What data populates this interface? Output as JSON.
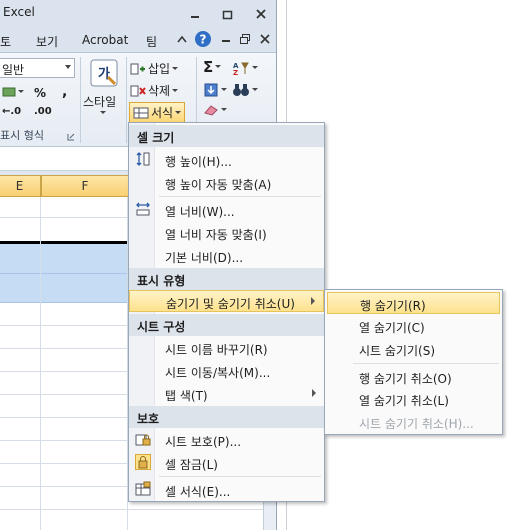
{
  "window": {
    "title": "Excel"
  },
  "menubar": {
    "tabs": [
      "토",
      "보기",
      "Acrobat",
      "팀"
    ]
  },
  "ribbon": {
    "number_format": "일반",
    "percent": "%",
    "comma": ",",
    "inc_decimal": "←.0",
    "dec_decimal": ".00",
    "number_group_label": "표시 형식",
    "style_label": "스타일",
    "insert_label": "삽입",
    "delete_label": "삭제",
    "format_label": "서식",
    "sum_symbol": "Σ"
  },
  "grid": {
    "column_label": "F",
    "column_label_left": "E"
  },
  "menu": {
    "sections": {
      "cell_size": "셀 크기",
      "visibility": "표시 유형",
      "organize": "시트 구성",
      "protection": "보호"
    },
    "items": {
      "row_height": "행 높이(H)...",
      "autofit_row": "행 높이 자동 맞춤(A)",
      "col_width": "열 너비(W)...",
      "autofit_col": "열 너비 자동 맞춤(I)",
      "default_width": "기본 너비(D)...",
      "hide_unhide": "숨기기 및 숨기기 취소(U)",
      "rename_sheet": "시트 이름 바꾸기(R)",
      "move_copy": "시트 이동/복사(M)...",
      "tab_color": "탭 색(T)",
      "protect_sheet": "시트 보호(P)...",
      "lock_cell": "셀 잠금(L)",
      "format_cells": "셀 서식(E)..."
    }
  },
  "submenu": {
    "items": {
      "hide_rows": "행 숨기기(R)",
      "hide_cols": "열 숨기기(C)",
      "hide_sheet": "시트 숨기기(S)",
      "unhide_rows": "행 숨기기 취소(O)",
      "unhide_cols": "열 숨기기 취소(L)",
      "unhide_sheet": "시트 숨기기 취소(H)..."
    }
  },
  "colors": {
    "highlight": "#fde28e",
    "selection": "#c6dcf4",
    "header_active": "#f9cf72"
  }
}
